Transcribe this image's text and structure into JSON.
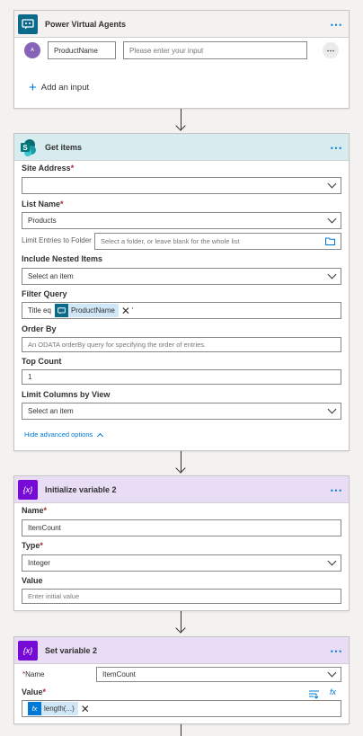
{
  "pva": {
    "title": "Power Virtual Agents",
    "input_name": "ProductName",
    "input_placeholder": "Please enter your input",
    "add_input": "Add an input",
    "more": "⋯",
    "row_more": "⋯",
    "avatar_text": "ᴬ"
  },
  "get_items": {
    "title": "Get items",
    "more": "⋯",
    "site_address_label": "Site Address",
    "site_address_value": "",
    "list_name_label": "List Name",
    "list_name_value": "Products",
    "limit_entries_label": "Limit Entries to Folder",
    "limit_entries_placeholder": "Select a folder, or leave blank for the whole list",
    "nested_label": "Include Nested Items",
    "nested_value": "Select an item",
    "filter_label": "Filter Query",
    "filter_prefix": "Title eq",
    "filter_token": "ProductName",
    "filter_suffix": "'",
    "orderby_label": "Order By",
    "orderby_placeholder": "An ODATA orderBy query for specifying the order of entries.",
    "topcount_label": "Top Count",
    "topcount_value": "1",
    "limitcols_label": "Limit Columns by View",
    "limitcols_value": "Select an item",
    "hide_advanced": "Hide advanced options",
    "required_mark": "*"
  },
  "init_var": {
    "title": "Initialize variable 2",
    "more": "⋯",
    "name_label": "Name",
    "name_value": "ItemCount",
    "type_label": "Type",
    "type_value": "Integer",
    "value_label": "Value",
    "value_placeholder": "Enter initial value",
    "required_mark": "*",
    "icon_text": "{x}"
  },
  "set_var": {
    "title": "Set variable 2",
    "more": "⋯",
    "name_label": "Name",
    "name_value": "ItemCount",
    "value_label": "Value",
    "value_token": "length(...)",
    "required_mark": "*",
    "icon_text": "{x}",
    "fx_text": "fx"
  },
  "colors": {
    "pva_header": "#f3f2f1",
    "sharepoint_header": "#d7ecef",
    "variable_header": "#e8ddf5",
    "variable_icon": "#770bd6",
    "link": "#0078d4",
    "sharepoint_icon": "#036c70"
  }
}
